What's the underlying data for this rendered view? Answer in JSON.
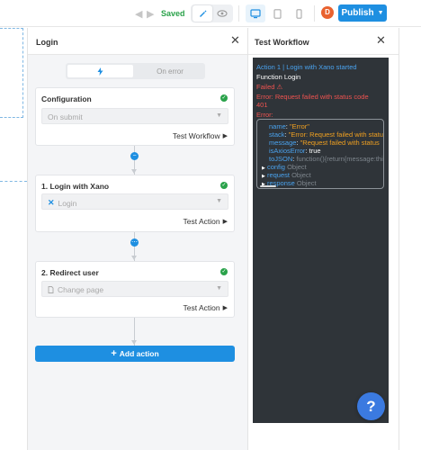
{
  "topbar": {
    "status": "Saved",
    "publish_label": "Publish",
    "avatar_initial": "D",
    "icons": [
      "undo-icon",
      "redo-icon",
      "pencil-icon",
      "eye-icon",
      "desktop-icon",
      "tablet-icon",
      "mobile-icon",
      "chevron-down-icon"
    ]
  },
  "login_panel": {
    "title": "Login",
    "toggle": {
      "active_icon": "lightning-icon",
      "inactive_label": "On error"
    },
    "cards": [
      {
        "title": "Configuration",
        "select_value": "On submit",
        "action_label": "Test Workflow"
      },
      {
        "title": "1. Login with Xano",
        "select_value": "Login",
        "select_icon": "xano-icon",
        "action_label": "Test Action"
      },
      {
        "title": "2. Redirect user",
        "select_value": "Change page",
        "select_icon": "page-icon",
        "action_label": "Test Action"
      }
    ],
    "add_action_label": "Add action"
  },
  "test_panel": {
    "title": "Test Workflow",
    "console": {
      "line1": "Action 1 | Login with Xano started",
      "line2": "Function Login",
      "line3": "Failed",
      "line4a": "Error: Request failed with status code",
      "line4b": "401",
      "line5": "Error:",
      "error_props": [
        {
          "key": "name",
          "value": "\"Error\""
        },
        {
          "key": "stack",
          "value": "\"Error: Request failed with status"
        },
        {
          "key": "message",
          "value": "\"Request failed with status"
        },
        {
          "key": "isAxiosError",
          "value": "true"
        },
        {
          "key": "toJSON",
          "value": "function(){return{message:this"
        },
        {
          "key": "config",
          "value": "Object"
        },
        {
          "key": "request",
          "value": "Object"
        },
        {
          "key": "response",
          "value": "Object"
        }
      ]
    }
  },
  "help_label": "?",
  "colors": {
    "accent": "#1e8fe1",
    "success": "#2aa24a",
    "error": "#ef5350",
    "console_bg": "#2f3439"
  }
}
